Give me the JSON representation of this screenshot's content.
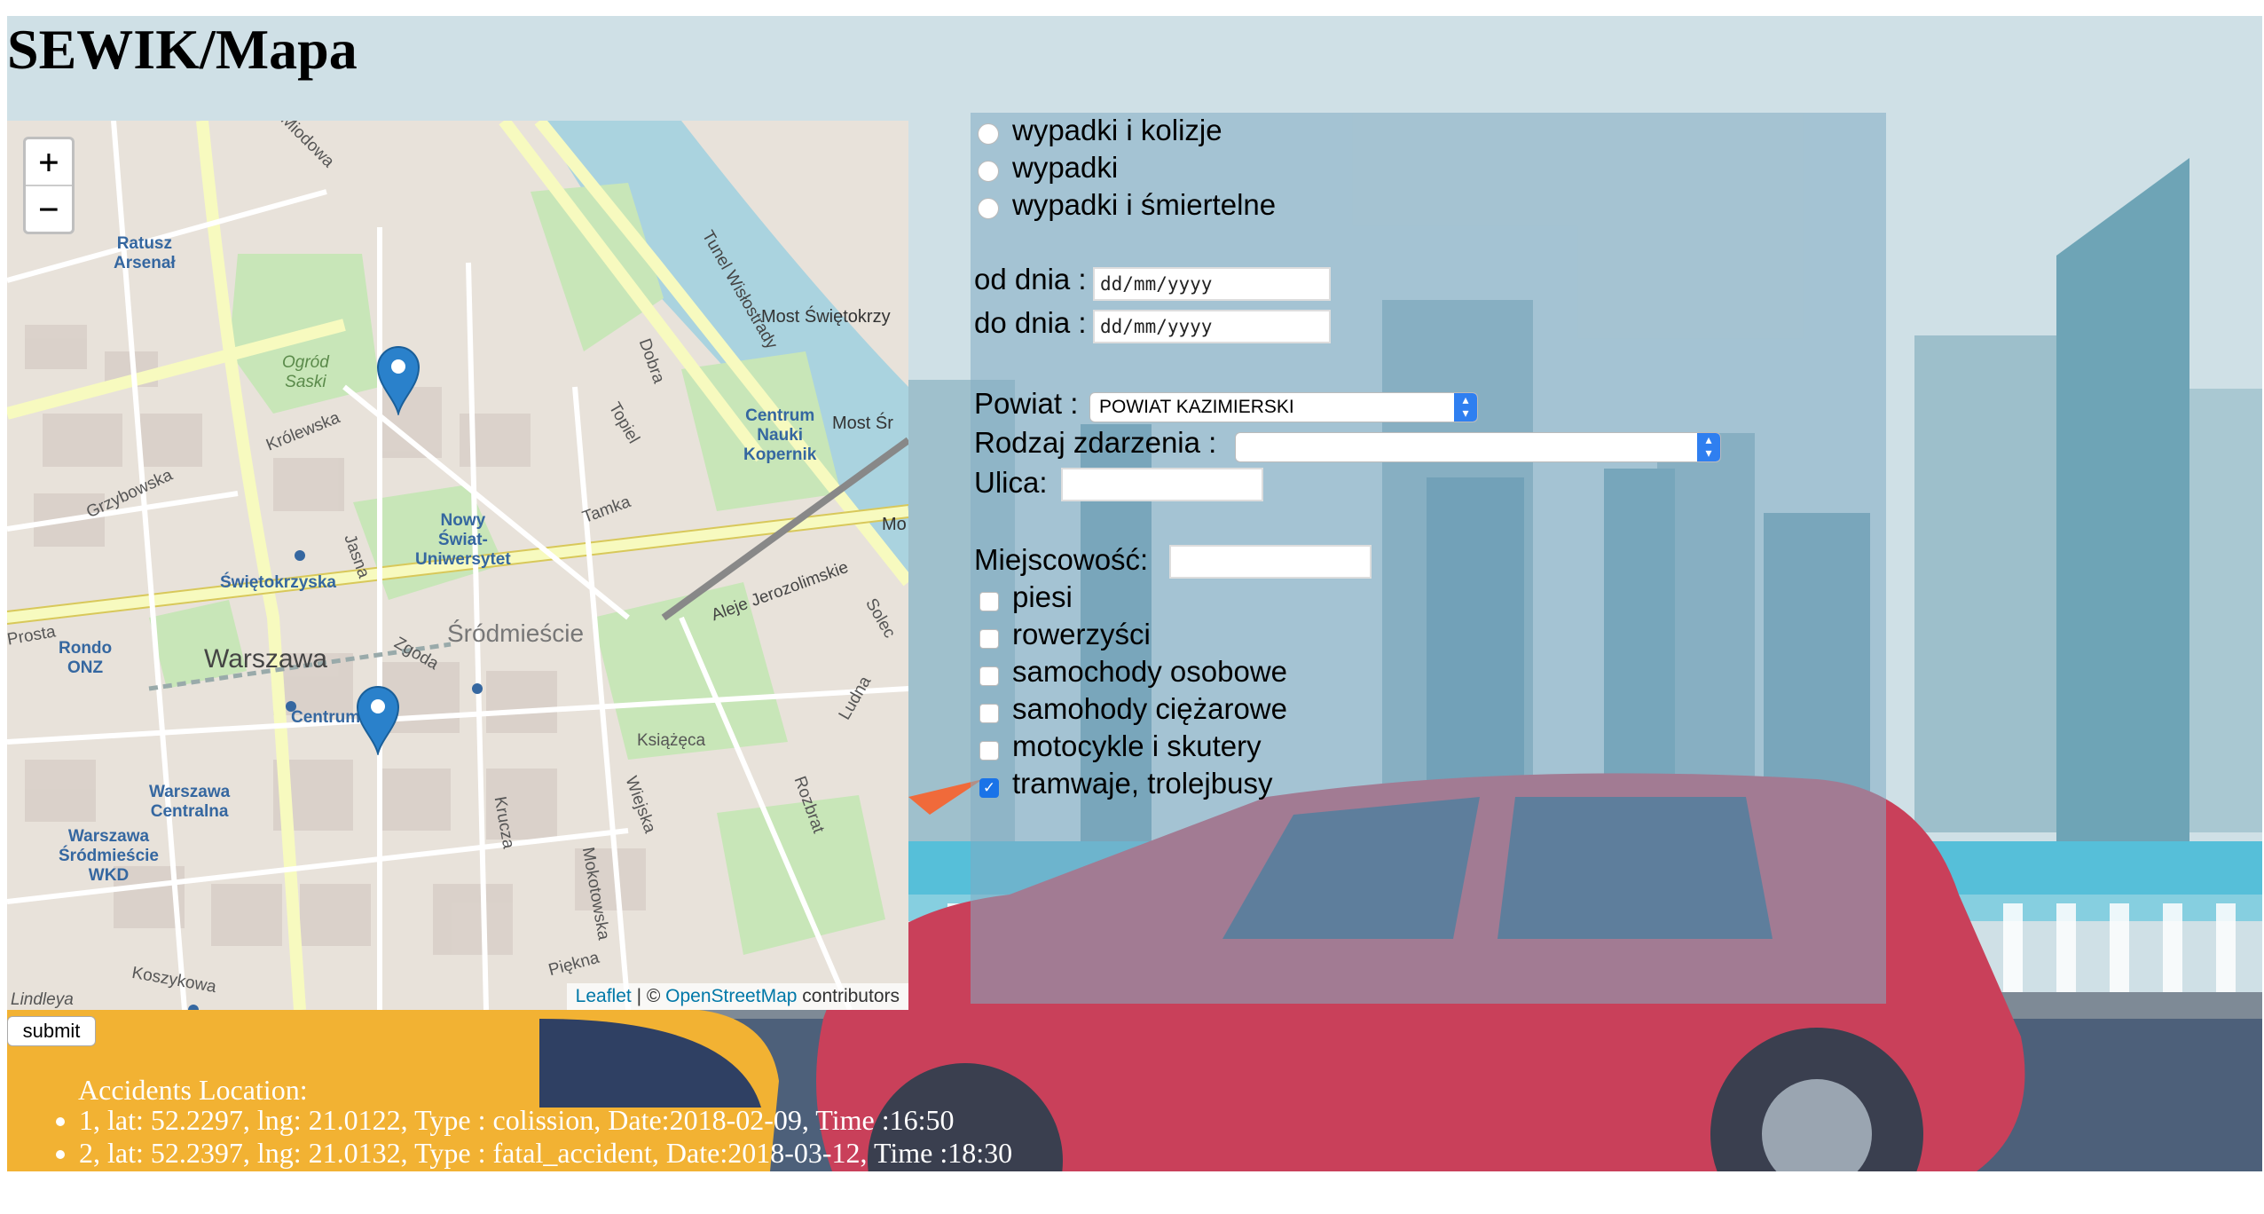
{
  "header": {
    "title": "SEWIK/Mapa"
  },
  "map": {
    "zoom_in": "+",
    "zoom_out": "−",
    "attribution": {
      "leaflet": "Leaflet",
      "sep": " | © ",
      "osm": "OpenStreetMap",
      "suffix": " contributors"
    },
    "labels": {
      "warszawa": "Warszawa",
      "srodmiescie": "Śródmieście",
      "nowy_swiat": "Nowy\nŚwiat-\nUniwersytet",
      "swietokrzyska": "Świętokrzyska",
      "ratusz": "Ratusz\nArsenał",
      "centrum_nauki": "Centrum\nNauki\nKopernik",
      "rondo": "Rondo\nONZ",
      "centrum": "Centrum",
      "warszawa_centralna": "Warszawa\nCentralna",
      "warszawa_srodmiescie": "Warszawa\nŚródmieście\nWKD",
      "ogrod": "Ogród\nSaski",
      "most": "Most Świętokrzy",
      "most2": "Most Śr",
      "krolewska": "Królewska",
      "grzybowska": "Grzybowska",
      "jasna": "Jasna",
      "zgoda": "Zgoda",
      "tamka": "Tamka",
      "dobra": "Dobra",
      "topiel": "Topiel",
      "solec": "Solec",
      "ksiazeca": "Książęca",
      "koszykowa": "Koszykowa",
      "krucza": "Krucza",
      "mokotowska": "Mokotowska",
      "wiejska": "Wiejska",
      "piekna": "Piękna",
      "rozbrat": "Rozbrat",
      "ludna": "Ludna",
      "aleje": "Aleje Jerozolimskie",
      "tunel": "Tunel Wisłostrady",
      "prosta": "Prosta",
      "lindleya": "Lindleya",
      "miodowa": "Miodowa",
      "mo": "Mo"
    }
  },
  "form": {
    "radios": [
      "wypadki i kolizje",
      "wypadki",
      "wypadki i śmiertelne"
    ],
    "od_dnia_label": "od dnia :",
    "do_dnia_label": "do dnia :",
    "date_placeholder": "dd/mm/yyyy",
    "powiat_label": "Powiat :",
    "powiat_value": "POWIAT KAZIMIERSKI",
    "rodzaj_label": "Rodzaj zdarzenia :",
    "rodzaj_value": "",
    "ulica_label": "Ulica:",
    "miejscowosc_label": "Miejscowość:",
    "checkboxes": [
      {
        "label": "piesi",
        "checked": false
      },
      {
        "label": "rowerzyści",
        "checked": false
      },
      {
        "label": "samochody osobowe",
        "checked": false
      },
      {
        "label": "samohody ciężarowe",
        "checked": false
      },
      {
        "label": "motocykle i skutery",
        "checked": false
      },
      {
        "label": "tramwaje, trolejbusy",
        "checked": true
      }
    ],
    "submit_label": "submit"
  },
  "accidents": {
    "heading": "Accidents Location:",
    "items": [
      "1, lat: 52.2297, lng: 21.0122, Type : colission, Date:2018-02-09, Time :16:50",
      "2, lat: 52.2397, lng: 21.0132, Type : fatal_accident, Date:2018-03-12, Time :18:30"
    ]
  }
}
